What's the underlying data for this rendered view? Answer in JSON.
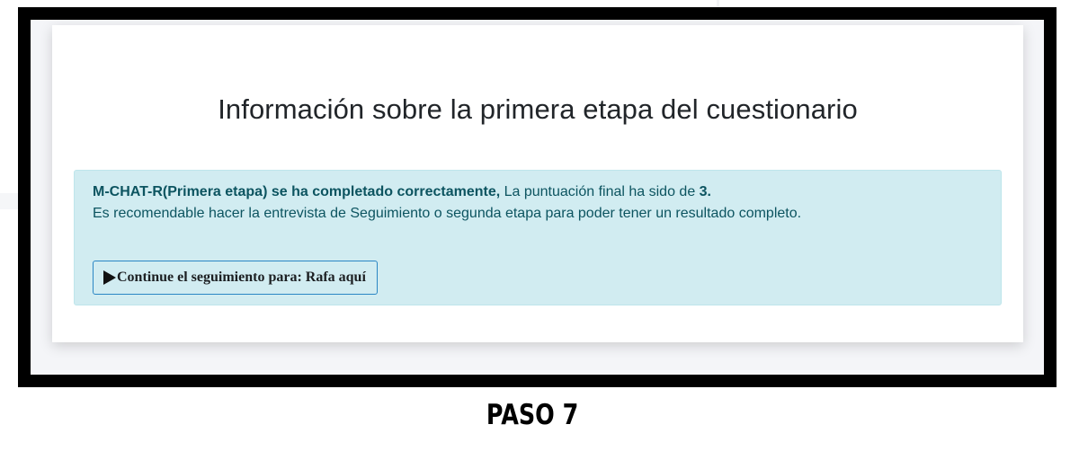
{
  "card": {
    "title": "Información sobre la primera etapa del cuestionario"
  },
  "alert": {
    "status_bold": "M-CHAT-R(Primera etapa) se ha completado correctamente,",
    "score_text": " La puntuación final ha sido de ",
    "score_value": "3.",
    "recommendation": "Es recomendable hacer la entrevista de Seguimiento o segunda etapa para poder tener un resultado completo.",
    "button_icon": "play-icon",
    "button_label": "Continue el seguimiento para: Rafa aquí"
  },
  "caption": {
    "step_label": "PASO 7"
  },
  "colors": {
    "alert_background": "#d1ecf1",
    "alert_border": "#bee5eb",
    "alert_text": "#0c5460",
    "button_border": "#2a86c4",
    "frame": "#000000"
  }
}
